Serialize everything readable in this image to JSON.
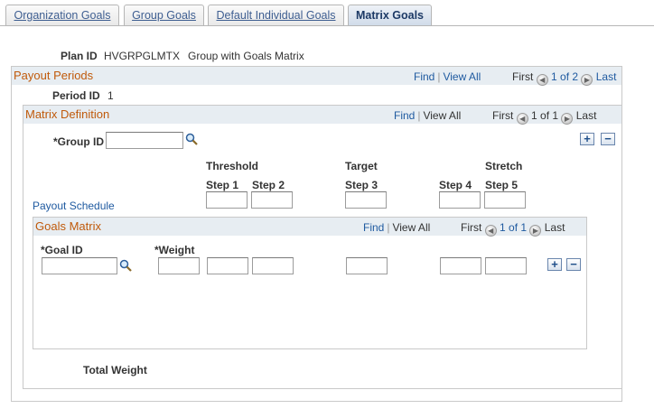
{
  "tabs": [
    {
      "label": "Organization Goals"
    },
    {
      "label": "Group Goals"
    },
    {
      "label": "Default Individual Goals"
    },
    {
      "label": "Matrix Goals"
    }
  ],
  "plan": {
    "label": "Plan ID",
    "id": "HVGRPGLMTX",
    "description": "Group with Goals Matrix"
  },
  "payout_periods": {
    "title": "Payout Periods",
    "find": "Find",
    "view_all": "View All",
    "first": "First",
    "counter": "1 of 2",
    "last": "Last",
    "period_label": "Period ID",
    "period_value": "1"
  },
  "matrix_definition": {
    "title": "Matrix Definition",
    "find": "Find",
    "view_all": "View All",
    "first": "First",
    "counter": "1 of 1",
    "last": "Last",
    "group_id_label": "*Group ID",
    "group_id_value": "",
    "payout_schedule": "Payout Schedule",
    "threshold": "Threshold",
    "target": "Target",
    "stretch": "Stretch",
    "steps": [
      "Step 1",
      "Step 2",
      "Step 3",
      "Step 4",
      "Step 5"
    ]
  },
  "goals_matrix": {
    "title": "Goals Matrix",
    "find": "Find",
    "view_all": "View All",
    "first": "First",
    "counter": "1 of 1",
    "last": "Last",
    "goal_id_label": "*Goal ID",
    "weight_label": "*Weight"
  },
  "total_weight_label": "Total Weight",
  "icons": {
    "add": "plus-icon",
    "delete": "minus-icon",
    "lookup": "magnifier-icon",
    "prev": "arrow-left-icon",
    "next": "arrow-right-icon"
  },
  "colors": {
    "section_title": "#c05a0b",
    "link": "#1f5aa0",
    "header_bg": "#e7edf2"
  }
}
